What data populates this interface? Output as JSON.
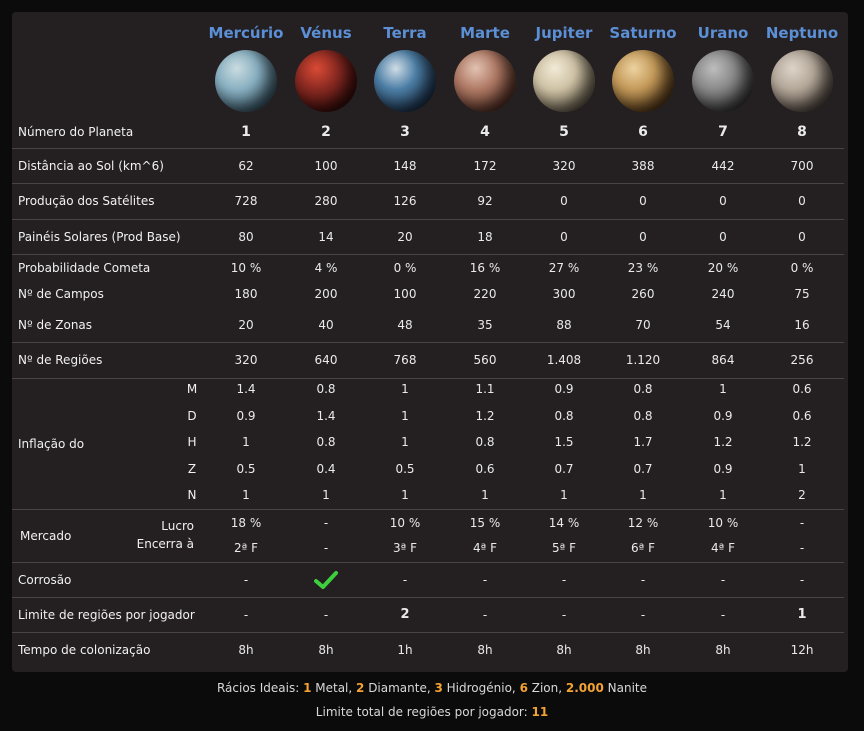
{
  "planets": [
    {
      "name": "Mercúrio",
      "number": "1",
      "distance": "62",
      "sat_production": "728",
      "solar_panels": "80",
      "comet_prob": "10 %",
      "fields": "180",
      "zones": "20",
      "regions": "320",
      "inflation": {
        "M": "1.4",
        "D": "0.9",
        "H": "1",
        "Z": "0.5",
        "N": "1"
      },
      "market_profit": "18 %",
      "market_closes": "2ª F",
      "corrosion": "-",
      "region_limit": "-",
      "colonization_time": "8h",
      "colors": [
        "#8ab1c2",
        "#3e5b6a",
        "#c9dbe0"
      ]
    },
    {
      "name": "Vénus",
      "number": "2",
      "distance": "100",
      "sat_production": "280",
      "solar_panels": "14",
      "comet_prob": "4 %",
      "fields": "200",
      "zones": "40",
      "regions": "640",
      "inflation": {
        "M": "0.8",
        "D": "1.4",
        "H": "0.8",
        "Z": "0.4",
        "N": "1"
      },
      "market_profit": "-",
      "market_closes": "-",
      "corrosion": "check",
      "region_limit": "-",
      "colonization_time": "8h",
      "colors": [
        "#8b2a22",
        "#3a0e0c",
        "#d94a34"
      ]
    },
    {
      "name": "Terra",
      "number": "3",
      "distance": "148",
      "sat_production": "126",
      "solar_panels": "20",
      "comet_prob": "0 %",
      "fields": "100",
      "zones": "48",
      "regions": "768",
      "inflation": {
        "M": "1",
        "D": "1",
        "H": "1",
        "Z": "0.5",
        "N": "1"
      },
      "market_profit": "10 %",
      "market_closes": "3ª F",
      "corrosion": "-",
      "region_limit": "2",
      "colonization_time": "1h",
      "colors": [
        "#4d7fa6",
        "#1e3650",
        "#cfdce6"
      ]
    },
    {
      "name": "Marte",
      "number": "4",
      "distance": "172",
      "sat_production": "92",
      "solar_panels": "18",
      "comet_prob": "16 %",
      "fields": "220",
      "zones": "35",
      "regions": "560",
      "inflation": {
        "M": "1.1",
        "D": "1.2",
        "H": "0.8",
        "Z": "0.6",
        "N": "1"
      },
      "market_profit": "15 %",
      "market_closes": "4ª F",
      "corrosion": "-",
      "region_limit": "-",
      "colonization_time": "8h",
      "colors": [
        "#b07b66",
        "#5a3428",
        "#e2c2b2"
      ]
    },
    {
      "name": "Jupiter",
      "number": "5",
      "distance": "320",
      "sat_production": "0",
      "solar_panels": "0",
      "comet_prob": "27 %",
      "fields": "300",
      "zones": "88",
      "regions": "1.408",
      "inflation": {
        "M": "0.9",
        "D": "0.8",
        "H": "1.5",
        "Z": "0.7",
        "N": "1"
      },
      "market_profit": "14 %",
      "market_closes": "5ª F",
      "corrosion": "-",
      "region_limit": "-",
      "colonization_time": "8h",
      "colors": [
        "#cfc3a6",
        "#6d6452",
        "#f2ead6"
      ]
    },
    {
      "name": "Saturno",
      "number": "6",
      "distance": "388",
      "sat_production": "0",
      "solar_panels": "0",
      "comet_prob": "23 %",
      "fields": "260",
      "zones": "70",
      "regions": "1.120",
      "inflation": {
        "M": "0.8",
        "D": "0.8",
        "H": "1.7",
        "Z": "0.7",
        "N": "1"
      },
      "market_profit": "12 %",
      "market_closes": "6ª F",
      "corrosion": "-",
      "region_limit": "-",
      "colonization_time": "8h",
      "colors": [
        "#c49a5a",
        "#5c3f1c",
        "#ecd2a0"
      ]
    },
    {
      "name": "Urano",
      "number": "7",
      "distance": "442",
      "sat_production": "0",
      "solar_panels": "0",
      "comet_prob": "20 %",
      "fields": "240",
      "zones": "54",
      "regions": "864",
      "inflation": {
        "M": "1",
        "D": "0.9",
        "H": "1.2",
        "Z": "0.9",
        "N": "1"
      },
      "market_profit": "10 %",
      "market_closes": "4ª F",
      "corrosion": "-",
      "region_limit": "-",
      "colonization_time": "8h",
      "colors": [
        "#8a8a8a",
        "#3b3b3b",
        "#bdbdbd"
      ]
    },
    {
      "name": "Neptuno",
      "number": "8",
      "distance": "700",
      "sat_production": "0",
      "solar_panels": "0",
      "comet_prob": "0 %",
      "fields": "75",
      "zones": "16",
      "regions": "256",
      "inflation": {
        "M": "0.6",
        "D": "0.6",
        "H": "1.2",
        "Z": "1",
        "N": "2"
      },
      "market_profit": "-",
      "market_closes": "-",
      "corrosion": "-",
      "region_limit": "1",
      "colonization_time": "12h",
      "colors": [
        "#b4a89a",
        "#5a5048",
        "#ddd4c8"
      ]
    }
  ],
  "labels": {
    "number": "Número do Planeta",
    "distance": "Distância ao Sol (km^6)",
    "sat_production": "Produção dos Satélites",
    "solar_panels": "Painéis Solares (Prod Base)",
    "comet_prob": "Probabilidade Cometa",
    "fields": "Nº de Campos",
    "zones": "Nº de Zonas",
    "regions": "Nº de Regiões",
    "inflation": "Inflação do",
    "inflation_keys": [
      "M",
      "D",
      "H",
      "Z",
      "N"
    ],
    "market": "Mercado",
    "market_profit": "Lucro",
    "market_closes": "Encerra à",
    "corrosion": "Corrosão",
    "region_limit": "Limite de regiões por jogador",
    "colonization_time": "Tempo de colonização"
  },
  "footer": {
    "ratios_label": "Rácios Ideais:",
    "ratios": [
      {
        "value": "1",
        "name": "Metal,"
      },
      {
        "value": "2",
        "name": "Diamante,"
      },
      {
        "value": "3",
        "name": "Hidrogénio,"
      },
      {
        "value": "6",
        "name": "Zion,"
      },
      {
        "value": "2.000",
        "name": "Nanite"
      }
    ],
    "total_limit_label": "Limite total de regiões por jogador:",
    "total_limit_value": "11"
  },
  "colors": {
    "panel": "#241f20",
    "planet_name": "#5b8fd6",
    "highlight": "#f3a233",
    "check": "#3ecf3e"
  }
}
